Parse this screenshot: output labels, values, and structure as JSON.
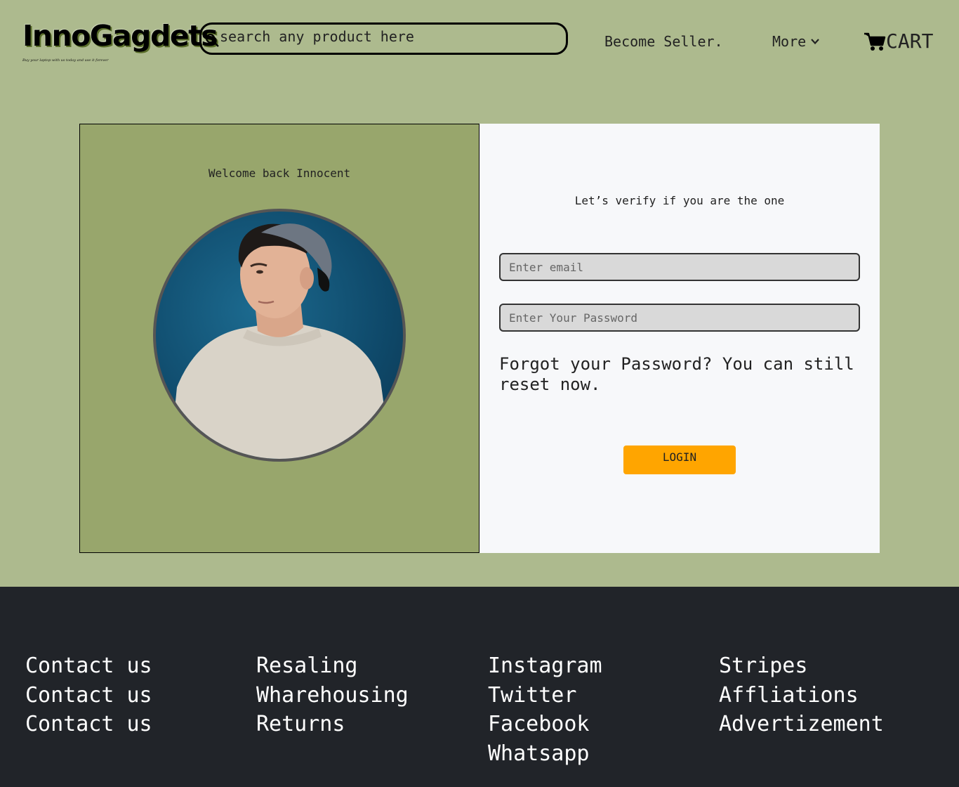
{
  "header": {
    "logo_text": "InnoGagdets",
    "tagline": "Buy your laptop with us today and use it forever",
    "search_placeholder": "search any product here",
    "become_seller": "Become Seller.",
    "more": "More",
    "cart": "CART"
  },
  "login": {
    "welcome": "Welcome back Innocent",
    "verify": "Let’s verify if you are the one",
    "email_placeholder": "Enter email",
    "password_placeholder": "Enter Your Password",
    "forgot": "Forgot your Password? You can still reset now.",
    "login_button": "LOGIN"
  },
  "footer": {
    "col1": [
      "Contact us",
      "Contact us",
      "Contact us"
    ],
    "col2": [
      "Resaling",
      "Wharehousing",
      "Returns"
    ],
    "col3": [
      "Instagram",
      "Twitter",
      "Facebook",
      "Whatsapp"
    ],
    "col4": [
      "Stripes",
      "Affliations",
      "Advertizement"
    ]
  },
  "colors": {
    "page_bg": "#adba8e",
    "left_panel_bg": "#98a66c",
    "right_panel_bg": "#f7f8fa",
    "login_button": "#ffa500",
    "footer_bg": "#212429"
  },
  "icons": {
    "search": "search-icon",
    "more": "chevron-down-icon",
    "cart": "cart-icon",
    "avatar": "user-photo"
  }
}
